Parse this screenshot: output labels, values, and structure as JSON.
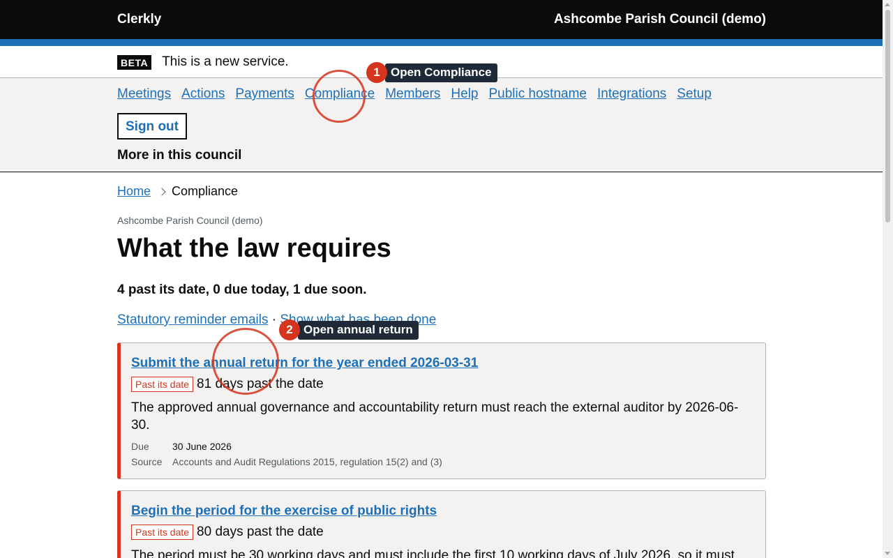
{
  "header": {
    "logo": "Clerkly",
    "council": "Ashcombe Parish Council (demo)"
  },
  "phase": {
    "tag": "BETA",
    "text": "This is a new service."
  },
  "nav": {
    "items": [
      "Meetings",
      "Actions",
      "Payments",
      "Compliance",
      "Members",
      "Help",
      "Public hostname",
      "Integrations",
      "Setup"
    ],
    "signout": "Sign out",
    "more": "More in this council"
  },
  "breadcrumb": {
    "home": "Home",
    "current": "Compliance"
  },
  "page": {
    "caption": "Ashcombe Parish Council (demo)",
    "title": "What the law requires",
    "summary": "4 past its date, 0 due today, 1 due soon.",
    "link_reminders": "Statutory reminder emails",
    "separator": "·",
    "link_done": "Show what has been done"
  },
  "cards": [
    {
      "title": "Submit the annual return for the year ended 2026-03-31",
      "badge": "Past its date",
      "status": "81 days past the date",
      "description": "The approved annual governance and accountability return must reach the external auditor by 2026-06-30.",
      "due_label": "Due",
      "due": "30 June 2026",
      "source_label": "Source",
      "source": "Accounts and Audit Regulations 2015, regulation 15(2) and (3)"
    },
    {
      "title": "Begin the period for the exercise of public rights",
      "badge": "Past its date",
      "status": "80 days past the date",
      "description": "The period must be 30 working days and must include the first 10 working days of July 2026, so it must"
    }
  ],
  "annotations": [
    {
      "number": "1",
      "label": "Open Compliance"
    },
    {
      "number": "2",
      "label": "Open annual return"
    }
  ],
  "colors": {
    "accent": "#1d70b8",
    "danger": "#d4351c",
    "header": "#0b0c0c",
    "nav_bg": "#f3f2f1"
  }
}
